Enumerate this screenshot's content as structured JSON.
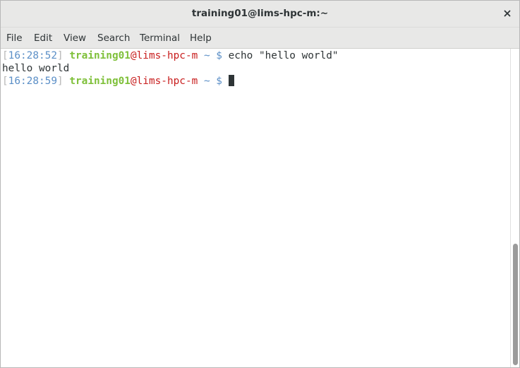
{
  "window": {
    "title": "training01@lims-hpc-m:~"
  },
  "menu": {
    "file": "File",
    "edit": "Edit",
    "view": "View",
    "search": "Search",
    "terminal": "Terminal",
    "help": "Help"
  },
  "terminal": {
    "lines": [
      {
        "bracket_open": "[",
        "time": "16:28:52",
        "bracket_close": "]",
        "user": "training01",
        "host": "@lims-hpc-m",
        "tilde": "~",
        "dollar": "$",
        "command": "echo \"hello world\""
      },
      {
        "output": "hello world"
      },
      {
        "bracket_open": "[",
        "time": "16:28:59",
        "bracket_close": "]",
        "user": "training01",
        "host": "@lims-hpc-m",
        "tilde": "~",
        "dollar": "$",
        "command": ""
      }
    ]
  },
  "colors": {
    "time": "#5b8fc7",
    "user": "#7fc03a",
    "host": "#c81e1e",
    "prompt_symbol": "#5b8fc7",
    "text": "#2e3436"
  },
  "icons": {
    "close": "close-icon"
  }
}
